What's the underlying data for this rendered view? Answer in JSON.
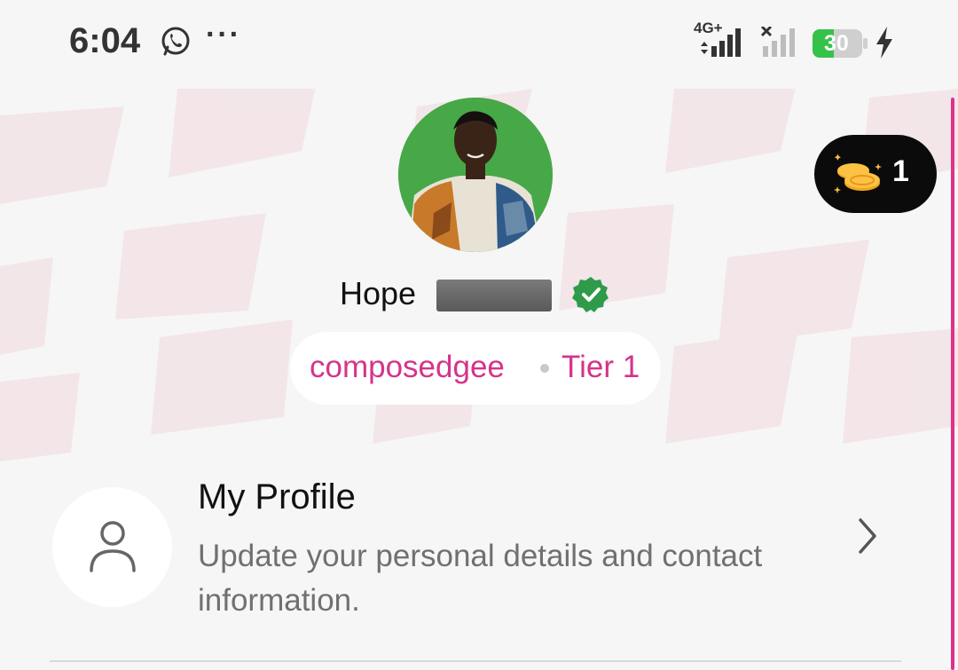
{
  "status_bar": {
    "time": "6:04",
    "network_type": "4G+",
    "battery_level": "30",
    "charging": true,
    "icons": [
      "whatsapp-icon",
      "more-dots-icon",
      "signal-icon",
      "no-signal-icon",
      "battery-icon",
      "charging-bolt-icon"
    ]
  },
  "header": {
    "coins_count": "1",
    "user_first_name": "Hope",
    "verified": true,
    "username": "composedgee",
    "tier": "Tier 1"
  },
  "menu": {
    "profile": {
      "title": "My Profile",
      "description": "Update your personal details and contact information."
    }
  },
  "colors": {
    "accent_pink": "#d6338a",
    "verified_green": "#2e9a4a",
    "avatar_bg": "#47a847",
    "badge_bg": "#0b0b0b"
  }
}
